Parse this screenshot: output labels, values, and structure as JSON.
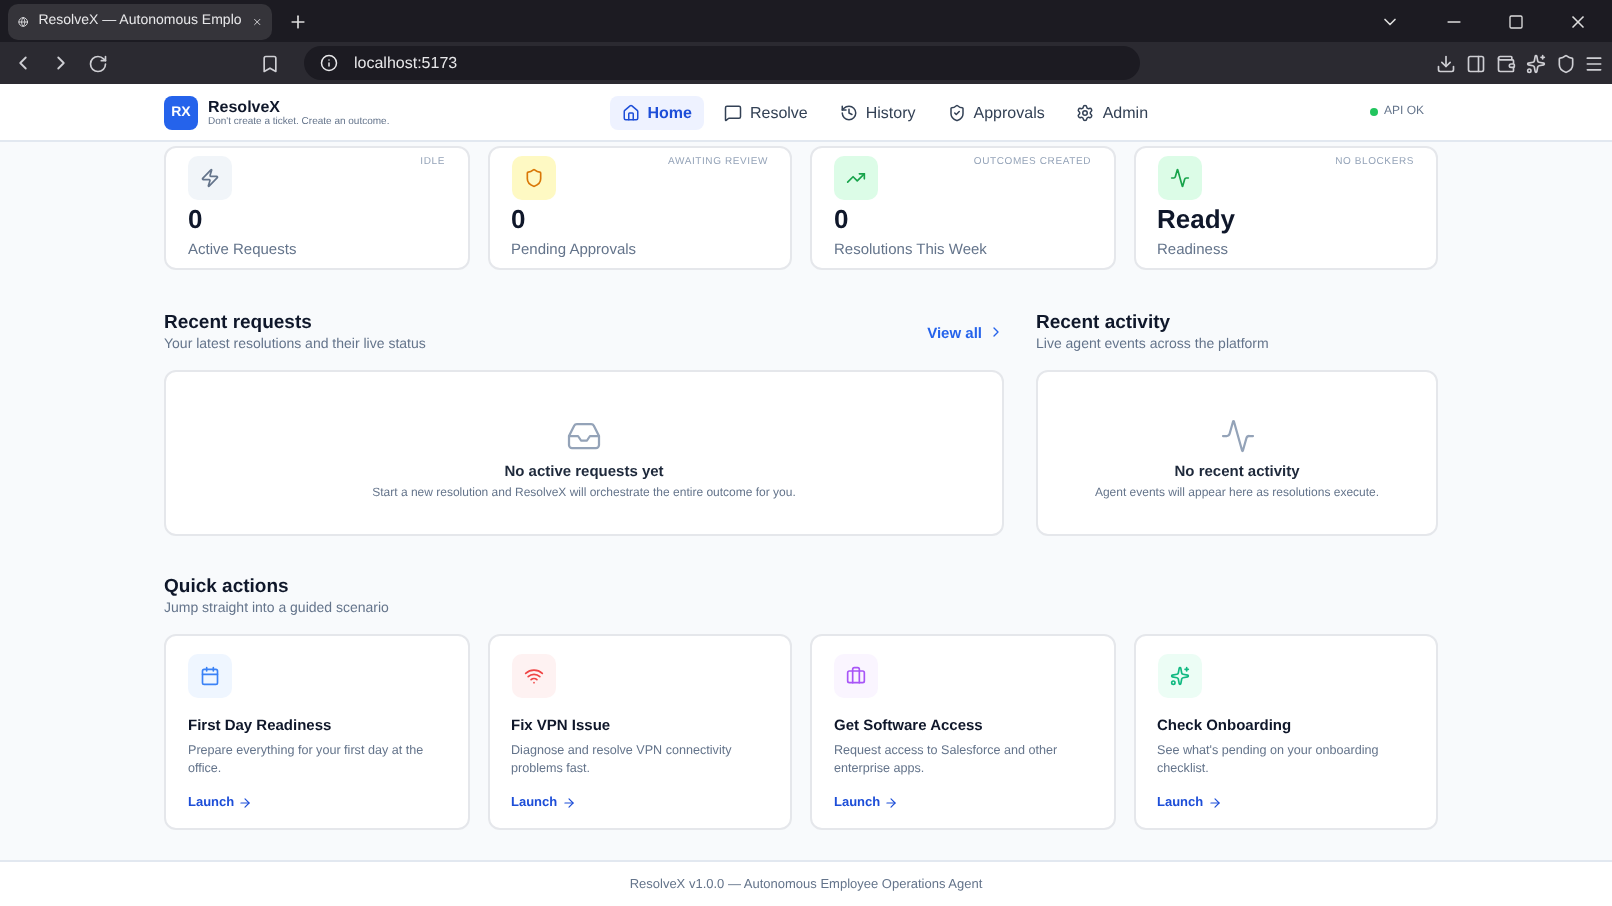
{
  "browser": {
    "tab_title": "ResolveX — Autonomous Emplo",
    "url": "localhost:5173"
  },
  "header": {
    "logo": "RX",
    "brand": "ResolveX",
    "tagline": "Don't create a ticket. Create an outcome.",
    "nav": [
      {
        "label": "Home",
        "kind": "home",
        "selected": true
      },
      {
        "label": "Resolve",
        "kind": "resolve",
        "selected": false
      },
      {
        "label": "History",
        "kind": "history",
        "selected": false
      },
      {
        "label": "Approvals",
        "kind": "approvals",
        "selected": false
      },
      {
        "label": "Admin",
        "kind": "admin",
        "selected": false
      }
    ],
    "status": "API OK"
  },
  "stats": [
    {
      "kind": "active",
      "tag": "IDLE",
      "value": "0",
      "label": "Active Requests"
    },
    {
      "kind": "pending",
      "tag": "AWAITING REVIEW",
      "value": "0",
      "label": "Pending Approvals"
    },
    {
      "kind": "resolutions",
      "tag": "OUTCOMES CREATED",
      "value": "0",
      "label": "Resolutions This Week"
    },
    {
      "kind": "readiness",
      "tag": "NO BLOCKERS",
      "value": "Ready",
      "label": "Readiness"
    }
  ],
  "recent_requests": {
    "title": "Recent requests",
    "subtitle": "Your latest resolutions and their live status",
    "link": "View all",
    "empty_title": "No active requests yet",
    "empty_text": "Start a new resolution and ResolveX will orchestrate the entire outcome for you."
  },
  "recent_activity": {
    "title": "Recent activity",
    "subtitle": "Live agent events across the platform",
    "empty_title": "No recent activity",
    "empty_text": "Agent events will appear here as resolutions execute."
  },
  "quick_actions": {
    "title": "Quick actions",
    "subtitle": "Jump straight into a guided scenario",
    "items": [
      {
        "kind": "calendar",
        "title": "First Day Readiness",
        "text": "Prepare everything for your first day at the office.",
        "link": "Launch"
      },
      {
        "kind": "vpn",
        "title": "Fix VPN Issue",
        "text": "Diagnose and resolve VPN connectivity problems fast.",
        "link": "Launch"
      },
      {
        "kind": "software",
        "title": "Get Software Access",
        "text": "Request access to Salesforce and other enterprise apps.",
        "link": "Launch"
      },
      {
        "kind": "onboarding",
        "title": "Check Onboarding",
        "text": "See what's pending on your onboarding checklist.",
        "link": "Launch"
      }
    ]
  },
  "footer": "ResolveX v1.0.0 — Autonomous Employee Operations Agent"
}
